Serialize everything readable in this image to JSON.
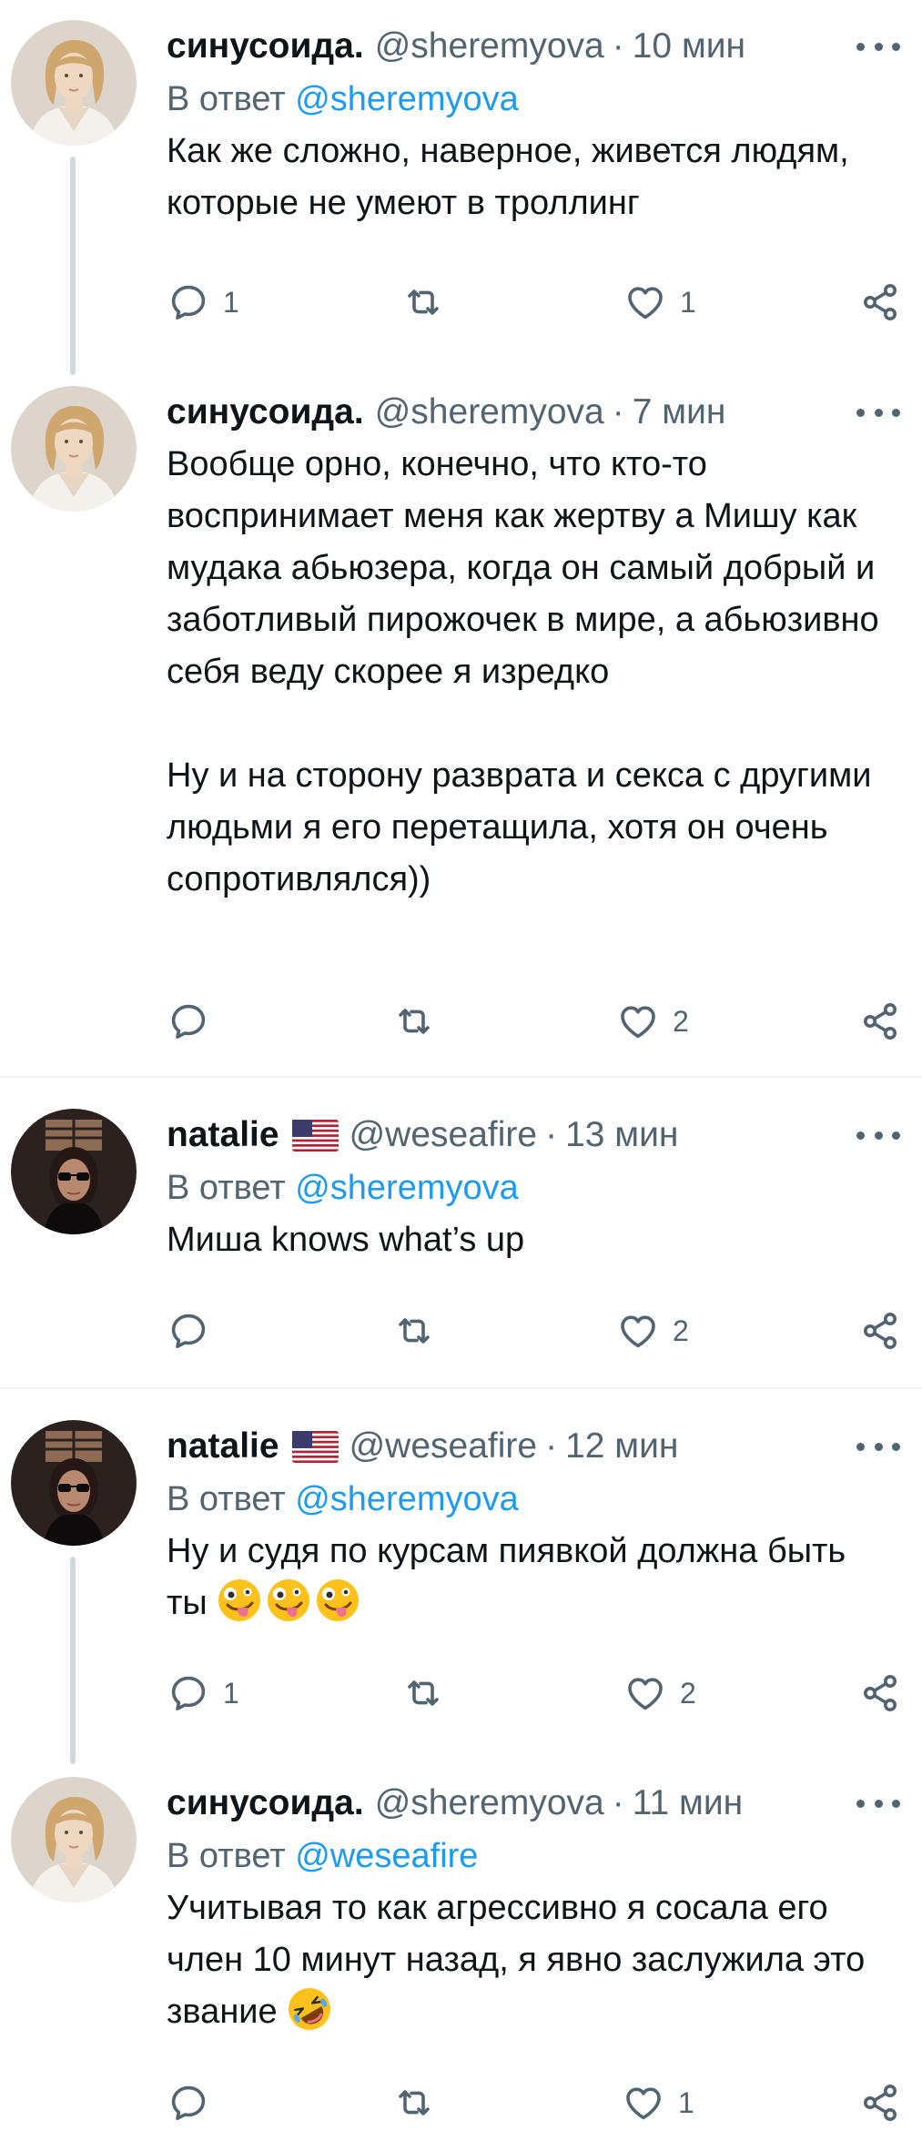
{
  "tweets": [
    {
      "name": "синусоида.",
      "handle": "@sheremyova",
      "dot": "·",
      "time": "10 мин",
      "reply_prefix": "В ответ",
      "reply_mention": "@sheremyova",
      "text": "Как же сложно, наверное, живется людям, которые не умеют в троллинг",
      "reply_count": "1",
      "retweet_count": "",
      "like_count": "1"
    },
    {
      "name": "синусоида.",
      "handle": "@sheremyova",
      "dot": "·",
      "time": "7 мин",
      "text": "Вообще орно, конечно, что кто-то воспринимает меня как жертву а Мишу как мудака абьюзера, когда он самый добрый и заботливый пирожочек в мире, а абьюзивно себя веду скорее я изредко\n\nНу и на сторону разврата и секса с другими людьми я его перетащила, хотя он очень сопротивлялся))",
      "reply_count": "",
      "retweet_count": "",
      "like_count": "2"
    },
    {
      "name": "natalie",
      "handle": "@weseafire",
      "dot": "·",
      "time": "13 мин",
      "reply_prefix": "В ответ",
      "reply_mention": "@sheremyova",
      "text": "Миша knows what’s up",
      "reply_count": "",
      "retweet_count": "",
      "like_count": "2"
    },
    {
      "name": "natalie",
      "handle": "@weseafire",
      "dot": "·",
      "time": "12 мин",
      "reply_prefix": "В ответ",
      "reply_mention": "@sheremyova",
      "text": "Ну и судя по курсам пиявкой должна быть ты",
      "reply_count": "1",
      "retweet_count": "",
      "like_count": "2"
    },
    {
      "name": "синусоида.",
      "handle": "@sheremyova",
      "dot": "·",
      "time": "11 мин",
      "reply_prefix": "В ответ",
      "reply_mention": "@weseafire",
      "text": "Учитывая то как агрессивно я сосала его член 10 минут назад, я явно заслужила это звание",
      "reply_count": "",
      "retweet_count": "",
      "like_count": "1"
    }
  ],
  "colors": {
    "text": "#0f1419",
    "secondary": "#536471",
    "accent": "#1d9bf0",
    "thread_line": "#cfd9de",
    "divider": "#eff3f4"
  },
  "icons": {
    "reply": "reply-icon",
    "retweet": "retweet-icon",
    "like": "heart-icon",
    "share": "share-icon",
    "more": "more-icon",
    "flag": "us-flag-icon",
    "emoji_zany": "zany-face-emoji",
    "emoji_rofl": "rofl-emoji"
  }
}
